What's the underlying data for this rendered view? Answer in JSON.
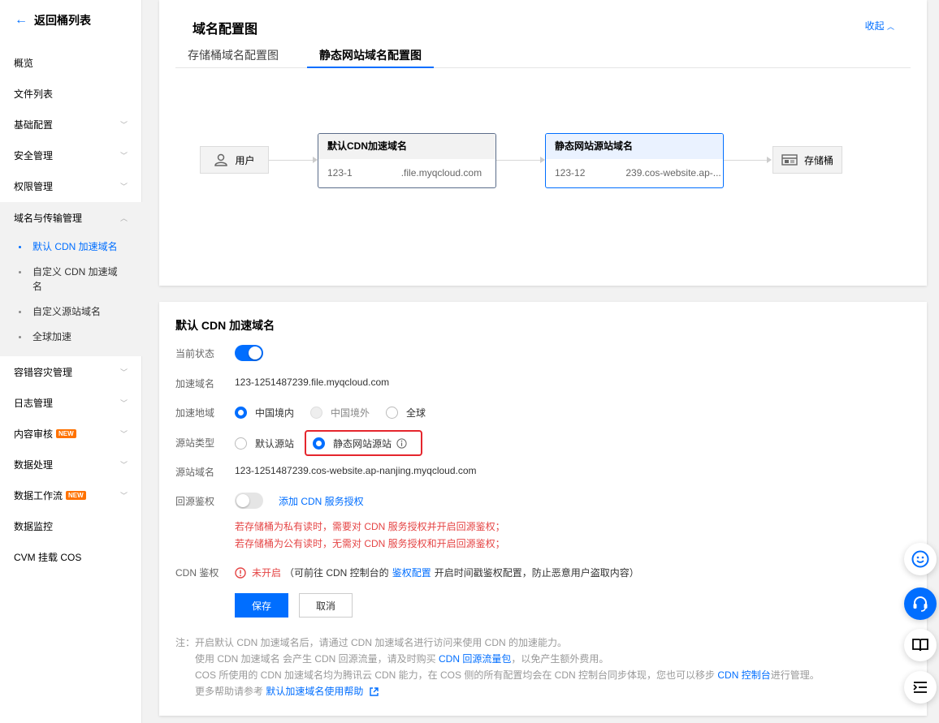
{
  "sidebar": {
    "back_label": "返回桶列表",
    "items": [
      {
        "label": "概览"
      },
      {
        "label": "文件列表"
      },
      {
        "label": "基础配置"
      },
      {
        "label": "安全管理"
      },
      {
        "label": "权限管理"
      },
      {
        "label": "域名与传输管理"
      },
      {
        "label": "容错容灾管理"
      },
      {
        "label": "日志管理"
      },
      {
        "label": "内容审核"
      },
      {
        "label": "数据处理"
      },
      {
        "label": "数据工作流"
      },
      {
        "label": "数据监控"
      },
      {
        "label": "CVM 挂载 COS"
      }
    ],
    "new_badge": "NEW",
    "sub_items": [
      {
        "label": "默认 CDN 加速域名"
      },
      {
        "label": "自定义 CDN 加速域名"
      },
      {
        "label": "自定义源站域名"
      },
      {
        "label": "全球加速"
      }
    ]
  },
  "domain_map": {
    "title": "域名配置图",
    "collapse_label": "收起",
    "tabs": [
      {
        "label": "存储桶域名配置图"
      },
      {
        "label": "静态网站域名配置图"
      }
    ],
    "user_label": "用户",
    "cdn_node": {
      "title": "默认CDN加速域名",
      "value_start": "123-1",
      "value_end": ".file.myqcloud.com"
    },
    "origin_node": {
      "title": "静态网站源站域名",
      "value_start": "123-12",
      "value_end": "239.cos-website.ap-..."
    },
    "bucket_label": "存储桶"
  },
  "cdn_form": {
    "title": "默认 CDN 加速域名",
    "status_label": "当前状态",
    "domain_label": "加速域名",
    "domain_value": "123-1251487239.file.myqcloud.com",
    "region_label": "加速地域",
    "region_options": [
      {
        "label": "中国境内"
      },
      {
        "label": "中国境外"
      },
      {
        "label": "全球"
      }
    ],
    "origin_type_label": "源站类型",
    "origin_type_options": [
      {
        "label": "默认源站"
      },
      {
        "label": "静态网站源站"
      }
    ],
    "origin_domain_label": "源站域名",
    "origin_domain_value": "123-1251487239.cos-website.ap-nanjing.myqcloud.com",
    "auth_label": "回源鉴权",
    "auth_link": "添加 CDN 服务授权",
    "warn_private": "若存储桶为私有读时，需要对 CDN 服务授权并开启回源鉴权；",
    "warn_public": "若存储桶为公有读时，无需对 CDN 服务授权和开启回源鉴权；",
    "cdn_auth_label": "CDN 鉴权",
    "cdn_auth_status": "未开启",
    "cdn_auth_desc_a": "（可前往 CDN 控制台的",
    "cdn_auth_link": "鉴权配置",
    "cdn_auth_desc_b": "开启时间戳鉴权配置，防止恶意用户盗取内容）",
    "save_label": "保存",
    "cancel_label": "取消"
  },
  "notes": {
    "prefix": "注：",
    "line1": "开启默认 CDN 加速域名后，请通过 CDN 加速域名进行访问来使用 CDN 的加速能力。",
    "line2_a": "使用 CDN 加速域名 会产生 CDN 回源流量，请及时购买",
    "line2_link": "CDN 回源流量包",
    "line2_b": "，以免产生额外费用。",
    "line3_a": "COS 所使用的 CDN 加速域名均为腾讯云 CDN 能力，在 COS 侧的所有配置均会在 CDN 控制台同步体现，您也可以移步",
    "line3_link": "CDN 控制台",
    "line3_b": "进行管理。",
    "line4_a": "更多帮助请参考",
    "line4_link": "默认加速域名使用帮助"
  },
  "colors": {
    "accent": "#006eff",
    "warning": "#e54545",
    "highlight_box": "#e5262d",
    "new_badge": "#ff7200"
  },
  "icons": [
    "back-arrow-icon",
    "chevron-down-icon",
    "chevron-up-icon",
    "user-icon",
    "bucket-icon",
    "info-icon",
    "error-icon",
    "external-link-icon",
    "smile-icon",
    "headset-icon",
    "book-icon",
    "menu-list-icon"
  ]
}
